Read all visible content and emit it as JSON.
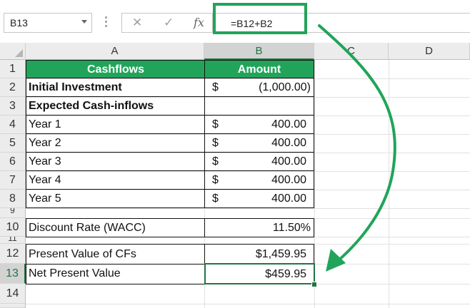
{
  "formula_bar": {
    "name_box": "B13",
    "cancel_icon": "✕",
    "enter_icon": "✓",
    "fx_icon": "fx",
    "formula": "=B12+B2"
  },
  "columns": [
    "A",
    "B",
    "C",
    "D"
  ],
  "rows": [
    "1",
    "2",
    "3",
    "4",
    "5",
    "6",
    "7",
    "8",
    "9",
    "10",
    "11",
    "12",
    "13",
    "14"
  ],
  "table": {
    "header": {
      "a": "Cashflows",
      "b": "Amount"
    },
    "initial_investment": {
      "label": "Initial Investment",
      "currency": "$",
      "value": "(1,000.00)"
    },
    "expected": {
      "label": "Expected Cash-inflows"
    },
    "years": [
      {
        "label": "Year 1",
        "currency": "$",
        "value": "400.00"
      },
      {
        "label": "Year 2",
        "currency": "$",
        "value": "400.00"
      },
      {
        "label": "Year 3",
        "currency": "$",
        "value": "400.00"
      },
      {
        "label": "Year 4",
        "currency": "$",
        "value": "400.00"
      },
      {
        "label": "Year 5",
        "currency": "$",
        "value": "400.00"
      }
    ],
    "discount": {
      "label": "Discount Rate (WACC)",
      "value": "11.50%"
    },
    "pv": {
      "label": "Present Value of CFs",
      "value": "$1,459.95"
    },
    "npv": {
      "label": "Net Present Value",
      "value": "$459.95"
    }
  },
  "colors": {
    "accent": "#21a45a",
    "excel_green": "#217346"
  }
}
